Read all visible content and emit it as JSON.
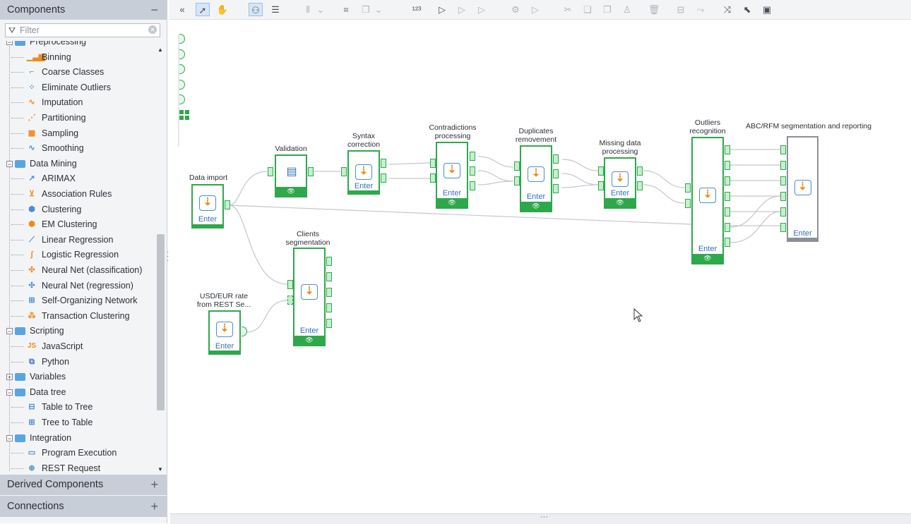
{
  "panels": {
    "components_title": "Components",
    "components_btn": "−",
    "derived_title": "Derived Components",
    "derived_btn": "+",
    "connections_title": "Connections",
    "connections_btn": "+"
  },
  "filter": {
    "placeholder": "Filter"
  },
  "tree": {
    "preprocessing_label": "Preprocessing",
    "items": [
      {
        "label": "Binning",
        "icon": "bar-chart-icon",
        "color": "#f08a1c",
        "glyph": "▁▃▆"
      },
      {
        "label": "Coarse Classes",
        "icon": "step-chart-icon",
        "color": "#4a8fd0",
        "glyph": "⌐"
      },
      {
        "label": "Eliminate Outliers",
        "icon": "scatter-icon",
        "color": "#4a8fd0",
        "glyph": "⁘"
      },
      {
        "label": "Imputation",
        "icon": "curve-icon",
        "color": "#f08a1c",
        "glyph": "∿"
      },
      {
        "label": "Partitioning",
        "icon": "partition-icon",
        "color": "#f08a1c",
        "glyph": "⋰"
      },
      {
        "label": "Sampling",
        "icon": "grid-sample-icon",
        "color": "#f08a1c",
        "glyph": "▦"
      },
      {
        "label": "Smoothing",
        "icon": "wave-icon",
        "color": "#4a8fd0",
        "glyph": "∿"
      }
    ],
    "data_mining_label": "Data Mining",
    "dm_items": [
      {
        "label": "ARIMAX",
        "icon": "line-trend-icon",
        "color": "#4a8fd0",
        "glyph": "↗"
      },
      {
        "label": "Association Rules",
        "icon": "cart-icon",
        "color": "#f08a1c",
        "glyph": "⊻"
      },
      {
        "label": "Clustering",
        "icon": "cube-icon",
        "color": "#4a8fd0",
        "glyph": "⬢"
      },
      {
        "label": "EM Clustering",
        "icon": "cube-orange-icon",
        "color": "#f08a1c",
        "glyph": "⬢"
      },
      {
        "label": "Linear Regression",
        "icon": "regression-line-icon",
        "color": "#4a8fd0",
        "glyph": "⟋"
      },
      {
        "label": "Logistic Regression",
        "icon": "logistic-curve-icon",
        "color": "#f08a1c",
        "glyph": "∫"
      },
      {
        "label": "Neural Net (classification)",
        "icon": "neural-net-icon",
        "color": "#f08a1c",
        "glyph": "✣"
      },
      {
        "label": "Neural Net (regression)",
        "icon": "neural-net-regression-icon",
        "color": "#4a8fd0",
        "glyph": "✣"
      },
      {
        "label": "Self-Organizing Network",
        "icon": "som-icon",
        "color": "#4a8fd0",
        "glyph": "⊞"
      },
      {
        "label": "Transaction Clustering",
        "icon": "transaction-cluster-icon",
        "color": "#f08a1c",
        "glyph": "⁂"
      }
    ],
    "scripting_label": "Scripting",
    "sc_items": [
      {
        "label": "JavaScript",
        "icon": "js-icon",
        "color": "#f08a1c",
        "glyph": "JS"
      },
      {
        "label": "Python",
        "icon": "python-icon",
        "color": "#3d79c1",
        "glyph": "⧉"
      }
    ],
    "variables_label": "Variables",
    "data_tree_label": "Data tree",
    "dt_items": [
      {
        "label": "Table to Tree",
        "icon": "table-tree-icon",
        "color": "#4a8fd0",
        "glyph": "⊟"
      },
      {
        "label": "Tree to Table",
        "icon": "tree-table-icon",
        "color": "#4a8fd0",
        "glyph": "⊞"
      }
    ],
    "integration_label": "Integration",
    "in_items": [
      {
        "label": "Program Execution",
        "icon": "terminal-icon",
        "color": "#4a8fd0",
        "glyph": "▭"
      },
      {
        "label": "REST Request",
        "icon": "rest-globe-icon",
        "color": "#4a8fd0",
        "glyph": "⊕"
      }
    ]
  },
  "nodes": {
    "data_import": {
      "label": "Data import",
      "enter": "Enter"
    },
    "validation": {
      "label": "Validation"
    },
    "syntax": {
      "label": "Syntax\ncorrection",
      "enter": "Enter"
    },
    "contradictions": {
      "label": "Contradictions\nprocessing",
      "enter": "Enter"
    },
    "duplicates": {
      "label": "Duplicates\nremovement",
      "enter": "Enter"
    },
    "missing": {
      "label": "Missing data\nprocessing",
      "enter": "Enter"
    },
    "outliers": {
      "label": "Outliers\nrecognition",
      "enter": "Enter"
    },
    "abc": {
      "label": "ABC/RFM segmentation and reporting",
      "enter": "Enter"
    },
    "clients": {
      "label": "Clients\nsegmentation",
      "enter": "Enter"
    },
    "usd": {
      "label": "USD/EUR rate\nfrom REST Se...",
      "enter": "Enter"
    }
  },
  "colors": {
    "node_green": "#2ea84b",
    "port_fill": "#c6efce",
    "accent_blue": "#4a8fd0",
    "accent_orange": "#f08a1c"
  }
}
